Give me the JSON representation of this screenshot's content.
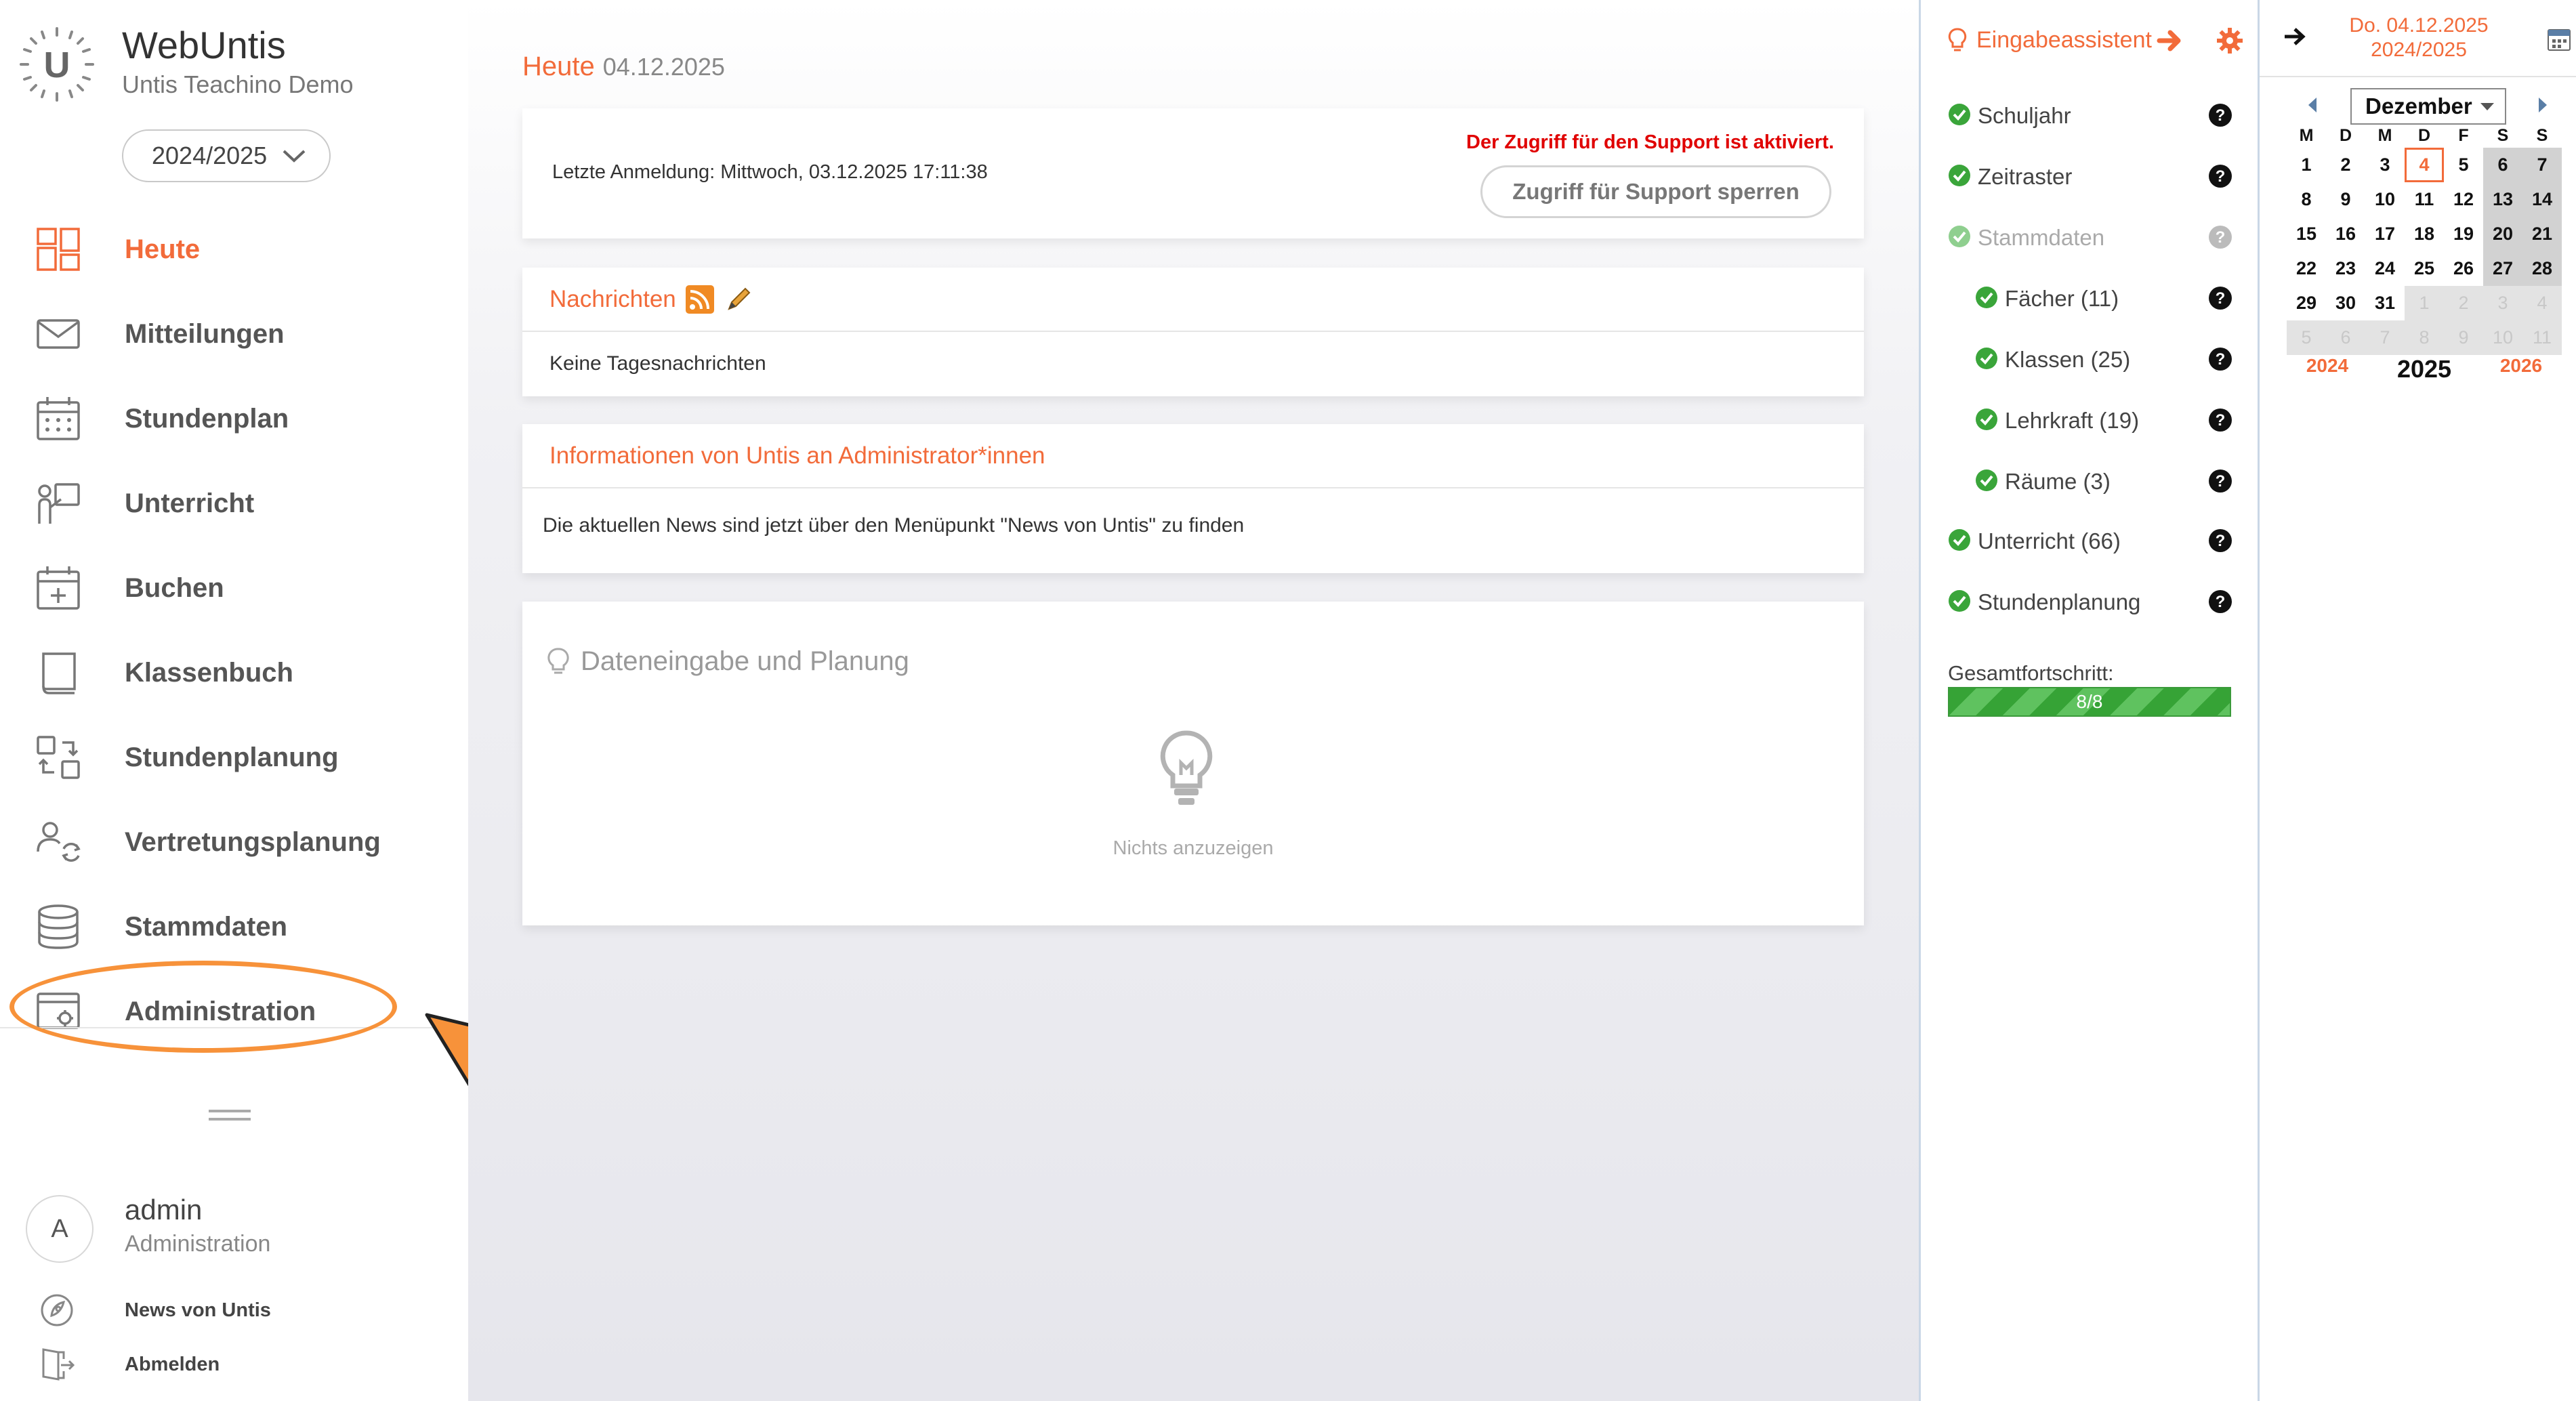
{
  "app": {
    "name": "WebUntis",
    "school": "Untis Teachino Demo",
    "school_year": "2024/2025",
    "accent_color": "#f26b3a"
  },
  "sidebar": {
    "items": [
      {
        "label": "Heute",
        "icon": "dashboard-icon",
        "active": true
      },
      {
        "label": "Mitteilungen",
        "icon": "envelope-icon"
      },
      {
        "label": "Stundenplan",
        "icon": "calendar-grid-icon"
      },
      {
        "label": "Unterricht",
        "icon": "teacher-board-icon"
      },
      {
        "label": "Buchen",
        "icon": "calendar-plus-icon"
      },
      {
        "label": "Klassenbuch",
        "icon": "book-icon"
      },
      {
        "label": "Stundenplanung",
        "icon": "swap-squares-icon"
      },
      {
        "label": "Vertretungsplanung",
        "icon": "person-refresh-icon"
      },
      {
        "label": "Stammdaten",
        "icon": "database-icon"
      },
      {
        "label": "Administration",
        "icon": "admin-settings-icon"
      }
    ],
    "user": {
      "initial": "A",
      "name": "admin",
      "role": "Administration"
    },
    "bottom_links": [
      {
        "label": "News von Untis",
        "icon": "rocket-icon"
      },
      {
        "label": "Abmelden",
        "icon": "logout-door-icon"
      }
    ]
  },
  "main": {
    "title": "Heute",
    "title_date": "04.12.2025",
    "login_card": {
      "last_login": "Letzte Anmeldung: Mittwoch, 03.12.2025 17:11:38",
      "support_warning": "Der Zugriff für den Support ist aktiviert.",
      "support_button": "Zugriff für Support sperren"
    },
    "news_card": {
      "title": "Nachrichten",
      "body": "Keine Tagesnachrichten"
    },
    "info_card": {
      "title": "Informationen von Untis an Administrator*innen",
      "body": "Die aktuellen News sind jetzt über den Menüpunkt \"News von Untis\" zu finden"
    },
    "planning_card": {
      "title": "Dateneingabe und Planung",
      "empty_text": "Nichts anzuzeigen"
    }
  },
  "assistant": {
    "title": "Eingabeassistent",
    "steps": [
      {
        "label": "Schuljahr",
        "level": 0,
        "muted": false
      },
      {
        "label": "Zeitraster",
        "level": 0,
        "muted": false
      },
      {
        "label": "Stammdaten",
        "level": 0,
        "muted": true
      },
      {
        "label": "Fächer (11)",
        "level": 1,
        "muted": false
      },
      {
        "label": "Klassen (25)",
        "level": 1,
        "muted": false
      },
      {
        "label": "Lehrkraft (19)",
        "level": 1,
        "muted": false
      },
      {
        "label": "Räume (3)",
        "level": 1,
        "muted": false
      },
      {
        "label": "Unterricht (66)",
        "level": 0,
        "muted": false
      },
      {
        "label": "Stundenplanung",
        "level": 0,
        "muted": false
      }
    ],
    "progress_label": "Gesamtfortschritt:",
    "progress_text": "8/8",
    "progress_fraction": 1.0
  },
  "calendar": {
    "date_line": "Do. 04.12.2025",
    "year_line": "2024/2025",
    "month": "Dezember",
    "weekdays": [
      "M",
      "D",
      "M",
      "D",
      "F",
      "S",
      "S"
    ],
    "weeks": [
      [
        "1",
        "2",
        "3",
        "4",
        "5",
        "6",
        "7"
      ],
      [
        "8",
        "9",
        "10",
        "11",
        "12",
        "13",
        "14"
      ],
      [
        "15",
        "16",
        "17",
        "18",
        "19",
        "20",
        "21"
      ],
      [
        "22",
        "23",
        "24",
        "25",
        "26",
        "27",
        "28"
      ],
      [
        "29",
        "30",
        "31",
        "1",
        "2",
        "3",
        "4"
      ],
      [
        "5",
        "6",
        "7",
        "8",
        "9",
        "10",
        "11"
      ]
    ],
    "today": "4",
    "prev_year": "2024",
    "current_year": "2025",
    "next_year": "2026"
  }
}
